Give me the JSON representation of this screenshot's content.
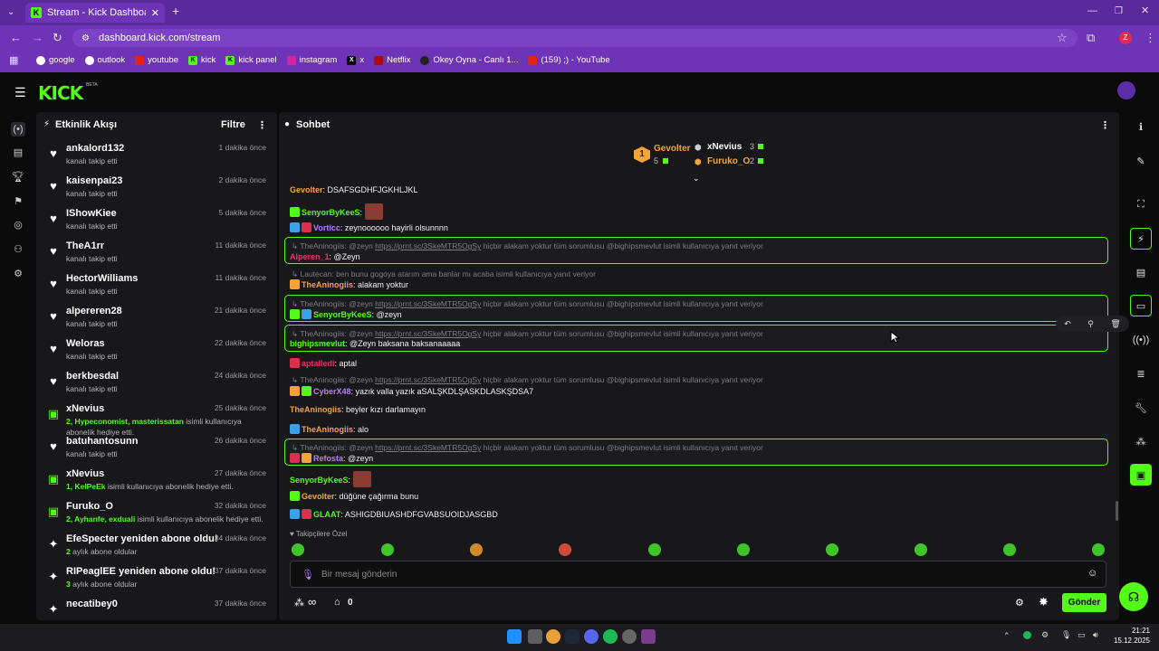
{
  "browser": {
    "tab_title": "Stream - Kick Dashboard",
    "url": "dashboard.kick.com/stream",
    "profile_initial": "Z",
    "bookmarks": [
      "google",
      "outlook",
      "youtube",
      "kick",
      "kick panel",
      "instagram",
      "x",
      "Netflix",
      "Okey Oyna - Canlı 1...",
      "(159) ;) - YouTube"
    ]
  },
  "header": {
    "logo": "KICK",
    "beta": "BETA"
  },
  "activity": {
    "title": "Etkinlik Akışı",
    "filter_label": "Filtre",
    "items": [
      {
        "icon": "heart-icon",
        "name": "ankalord132",
        "sub": "kanalı takip etti",
        "time": "1 dakika önce"
      },
      {
        "icon": "heart-icon",
        "name": "kaisenpai23",
        "sub": "kanalı takip etti",
        "time": "2 dakika önce"
      },
      {
        "icon": "heart-icon",
        "name": "IShowKiee",
        "sub": "kanalı takip etti",
        "time": "5 dakika önce"
      },
      {
        "icon": "heart-icon",
        "name": "TheA1rr",
        "sub": "kanalı takip etti",
        "time": "11 dakika önce"
      },
      {
        "icon": "heart-icon",
        "name": "HectorWilliams",
        "sub": "kanalı takip etti",
        "time": "11 dakika önce"
      },
      {
        "icon": "heart-icon",
        "name": "alpereren28",
        "sub": "kanalı takip etti",
        "time": "21 dakika önce"
      },
      {
        "icon": "heart-icon",
        "name": "Weloras",
        "sub": "kanalı takip etti",
        "time": "22 dakika önce"
      },
      {
        "icon": "heart-icon",
        "name": "berkbesdal",
        "sub": "kanalı takip etti",
        "time": "24 dakika önce"
      },
      {
        "icon": "gift-icon",
        "name": "xNevius",
        "sub_hl": "2, Hypeconomist, masterissatan",
        "sub": "isimli kullanıcıya",
        "sub2": "abonelik hediye etti.",
        "time": "25 dakika önce"
      },
      {
        "icon": "heart-icon",
        "name": "batuhantosunn",
        "sub": "kanalı takip etti",
        "time": "26 dakika önce"
      },
      {
        "icon": "gift-icon",
        "name": "xNevius",
        "sub_hl": "1, KelPeEk",
        "sub": "isimli kullanıcıya abonelik hediye etti.",
        "time": "27 dakika önce"
      },
      {
        "icon": "gift-icon",
        "name": "Furuko_O",
        "sub_hl": "2, Ayhanfe, exduali",
        "sub": "isimli kullanıcıya abonelik hediye etti.",
        "time": "32 dakika önce"
      },
      {
        "icon": "star-icon",
        "name": "EfeSpecter yeniden abone oldu!",
        "sub_hl": "2",
        "sub": "aylık abone oldular",
        "time": "34 dakika önce"
      },
      {
        "icon": "star-icon",
        "name": "RIPeaglEE yeniden abone oldu!",
        "sub_hl": "3",
        "sub": "aylık abone oldular",
        "time": "37 dakika önce"
      },
      {
        "icon": "star-icon",
        "name": "necatibey0",
        "sub": "",
        "time": "37 dakika önce"
      }
    ]
  },
  "chat": {
    "title": "Sohbet",
    "leaderboard": {
      "first": {
        "rank": "1",
        "name": "Gevolter",
        "count": "5"
      },
      "second": {
        "name": "xNevius",
        "count": "3"
      },
      "third": {
        "name": "Furuko_O",
        "count": "2"
      }
    },
    "messages": [
      {
        "user": "Gevolter",
        "color": "#f2a33a",
        "text": ": DSAFSGDHFJGKHLJKL"
      },
      {
        "user": "SenyorByKeeS",
        "color": "#53fc18",
        "text": ":"
      },
      {
        "user": "Vorticc",
        "color": "#b97cff",
        "text": ": zeynoooooo hayirli olsunnnn"
      },
      {
        "reply": "TheAninogiis: @zeyn",
        "link": "https://prnt.sc/3SkeMTR5OgSy",
        "reply_tail": "hiçbir alakam yoktur tüm sorumlusu @bighipsmevlut isimli kullanıcıya yanıt veriyor",
        "user": "Alperen_1",
        "color": "#e8316a",
        "text": ": @Zeyn"
      },
      {
        "reply": "Lautecan: ben bunu gogoya atarım ama banlar mı acaba isimli kullanıcıya yanıt veriyor",
        "user": "TheAninogiis",
        "color": "#f2a33a",
        "text": ": alakam yoktur"
      },
      {
        "reply": "TheAninogiis: @zeyn",
        "link": "https://prnt.sc/3SkeMTR5OgSy",
        "reply_tail": "hiçbir alakam yoktur tüm sorumlusu @bighipsmevlut isimli kullanıcıya yanıt veriyor",
        "user": "SenyorByKeeS",
        "color": "#53fc18",
        "text": ": @zeyn"
      },
      {
        "reply": "TheAninogiis: @zeyn",
        "link": "https://prnt.sc/3SkeMTR5OgSy",
        "reply_tail": "hiçbir alakam yoktur tüm sorumlusu @bighipsmevlut isimli kullanıcıya yanıt veriyor",
        "user": "bighipsmevlut",
        "color": "#53fc18",
        "text": ": @Zeyn baksana baksanaaaaa"
      },
      {
        "user": "aptalledi",
        "color": "#e8316a",
        "text": ": aptal"
      },
      {
        "reply": "TheAninogiis: @zeyn",
        "link": "https://prnt.sc/3SkeMTR5OgSy",
        "reply_tail": "hiçbir alakam yoktur tüm sorumlusu @bighipsmevlut isimli kullanıcıya yanıt veriyor",
        "user": "CyberX48",
        "color": "#b97cff",
        "text": ": yazık valla yazık aSALŞKDLŞASKDLASKŞDSA7"
      },
      {
        "user": "TheAninogiis",
        "color": "#f2a33a",
        "text": ": beyler kızı darlamayın"
      },
      {
        "user": "TheAninogiis",
        "color": "#f2a33a",
        "text": ": alo"
      },
      {
        "reply": "TheAninogiis: @zeyn",
        "link": "https://prnt.sc/3SkeMTR5OgSy",
        "reply_tail": "hiçbir alakam yoktur tüm sorumlusu @bighipsmevlut isimli kullanıcıya yanıt veriyor",
        "user": "Refosta",
        "color": "#b97cff",
        "text": ": @zeyn"
      },
      {
        "user": "SenyorByKeeS",
        "color": "#53fc18",
        "text": ":"
      },
      {
        "user": "Gevolter",
        "color": "#f2a33a",
        "text": ": düğüne çağırma bunu"
      },
      {
        "user": "GLAAT",
        "color": "#53fc18",
        "text": ": ASHIGDBIUASHDFGVABSUOIDJASGBD"
      }
    ],
    "followers_only_label": "Takipçilere Özel",
    "input_placeholder": "Bir mesaj gönderin",
    "infinity_label": "∞",
    "store_count": "0",
    "send_label": "Gönder"
  },
  "taskbar": {
    "time": "21:21",
    "date": "15.12.2025"
  },
  "colors": {
    "accent": "#53fc18",
    "panel": "#18181b",
    "background": "#0b0b0c",
    "chrome": "#6e34b8"
  }
}
